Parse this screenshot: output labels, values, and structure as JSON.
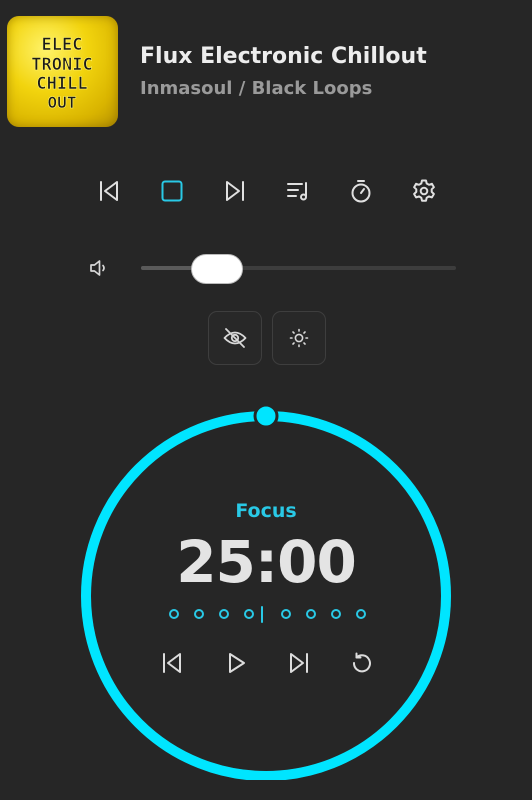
{
  "track": {
    "title": "Flux Electronic Chillout",
    "artist": "Inmasoul / Black Loops",
    "cover_text": [
      "ELEC",
      "TRONIC",
      "CHILL",
      "OUT"
    ]
  },
  "toolbar": {
    "items": [
      {
        "name": "previous",
        "icon": "skip-back-icon"
      },
      {
        "name": "stop",
        "icon": "stop-icon",
        "active": true
      },
      {
        "name": "next",
        "icon": "skip-forward-icon"
      },
      {
        "name": "playlist",
        "icon": "playlist-icon"
      },
      {
        "name": "timer",
        "icon": "stopwatch-icon"
      },
      {
        "name": "settings",
        "icon": "gear-icon"
      }
    ]
  },
  "volume": {
    "level": 0.24,
    "icon": "speaker-icon"
  },
  "toggles": [
    {
      "name": "hide-visuals",
      "icon": "eye-off-icon"
    },
    {
      "name": "brightness",
      "icon": "sun-icon"
    }
  ],
  "timer": {
    "mode": "Focus",
    "time": "25:00",
    "progress": 1.0,
    "sessions_before_break": 4,
    "sessions_after_break": 4
  },
  "colors": {
    "accent": "#00e5ff",
    "accent_text": "#29c9e6",
    "background": "#262626",
    "cover": "#f2d40e"
  }
}
